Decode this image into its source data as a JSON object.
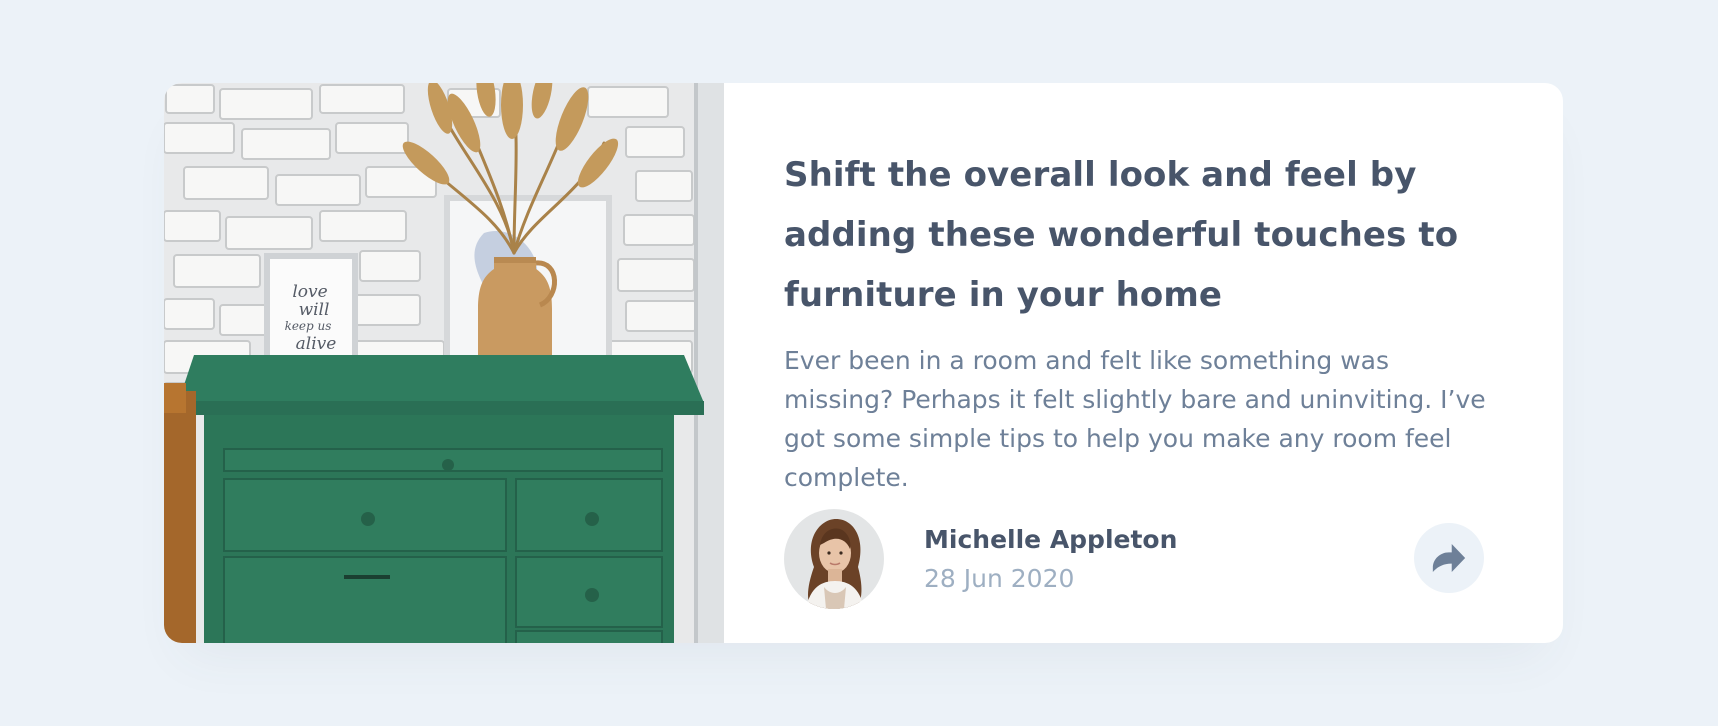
{
  "article": {
    "title": "Shift the overall look and feel by adding these wonderful touches to furniture in your home",
    "excerpt": "Ever been in a room and felt like something was missing? Perhaps it felt slightly bare and uninviting. I’ve got some simple tips to help you make any room feel complete.",
    "image_alt": "Green drawer cabinet with a vase of dried grass and framed pictures"
  },
  "author": {
    "name": "Michelle Appleton",
    "date": "28 Jun 2020",
    "avatar_alt": "Michelle Appleton avatar"
  },
  "share": {
    "icon": "share-arrow-icon",
    "aria_label": "Share"
  },
  "colors": {
    "background": "#ecf2f8",
    "card": "#ffffff",
    "heading": "#48556a",
    "body_text": "#6e8098",
    "muted_text": "#9eafc2",
    "share_icon": "#6e8098",
    "cabinet_green": "#2f7d5f"
  }
}
